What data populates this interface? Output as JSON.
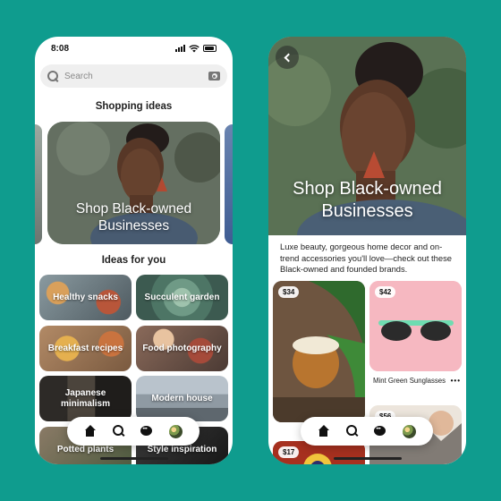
{
  "status_bar": {
    "time": "8:08"
  },
  "search": {
    "placeholder": "Search"
  },
  "feed": {
    "shopping_title": "Shopping ideas",
    "hero_card_title": "Shop Black-owned Businesses",
    "ideas_title": "Ideas for you",
    "ideas": [
      {
        "label": "Healthy snacks"
      },
      {
        "label": "Succulent garden"
      },
      {
        "label": "Breakfast recipes"
      },
      {
        "label": "Food photography"
      },
      {
        "label": "Japanese minimalism"
      },
      {
        "label": "Modern house"
      },
      {
        "label": "Potted plants"
      },
      {
        "label": "Style inspiration"
      }
    ]
  },
  "detail": {
    "title": "Shop Black-owned Businesses",
    "description": "Luxe beauty, gorgeous home decor and on-trend accessories you'll love—check out these Black-owned and founded brands.",
    "pins": [
      {
        "price": "$34"
      },
      {
        "price": "$42",
        "caption": "Mint Green Sunglasses"
      },
      {
        "price": "$17"
      },
      {
        "price": "$56"
      }
    ]
  },
  "nav": {
    "items": [
      "home-icon",
      "search-icon",
      "chat-icon",
      "profile-avatar"
    ]
  },
  "colors": {
    "background": "#0f9c8e",
    "sunglasses_bg": "#f6b8c1"
  }
}
